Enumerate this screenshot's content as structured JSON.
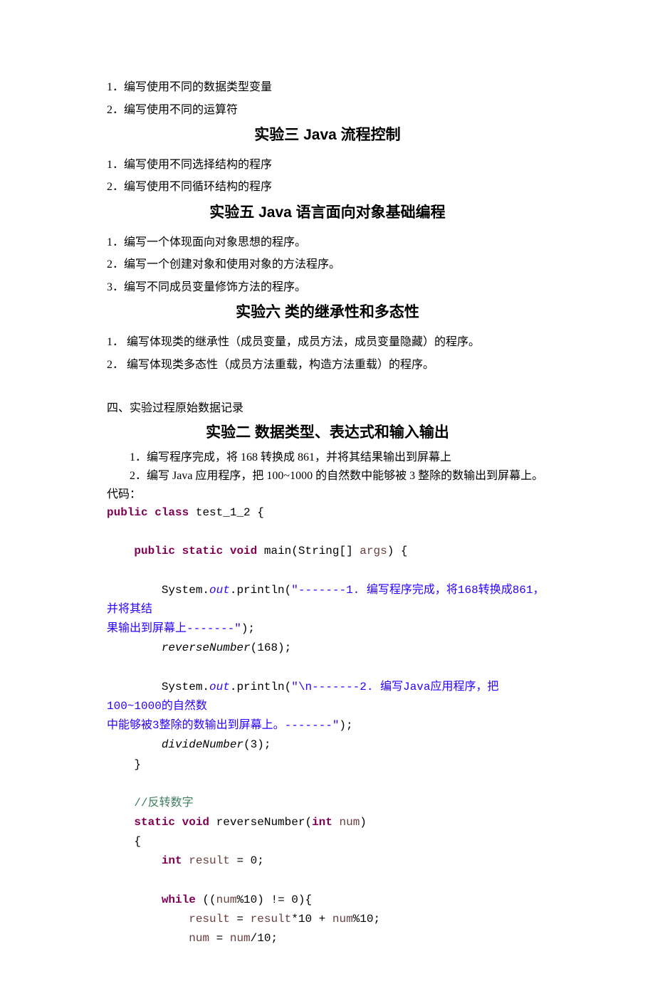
{
  "listTop": [
    "1．编写使用不同的数据类型变量",
    "2．编写使用不同的运算符"
  ],
  "heading3": "实验三  Java 流程控制",
  "list3": [
    "1．编写使用不同选择结构的程序",
    "2．编写使用不同循环结构的程序"
  ],
  "heading5": "实验五  Java 语言面向对象基础编程",
  "list5": [
    "1．编写一个体现面向对象思想的程序。",
    "2．编写一个创建对象和使用对象的方法程序。",
    "3．编写不同成员变量修饰方法的程序。"
  ],
  "heading6": "实验六  类的继承性和多态性",
  "list6": [
    "1． 编写体现类的继承性（成员变量，成员方法，成员变量隐藏）的程序。",
    "2． 编写体现类多态性（成员方法重载，构造方法重载）的程序。"
  ],
  "section4Title": "四、实验过程原始数据记录",
  "heading2b": "实验二  数据类型、表达式和输入输出",
  "sec4List": [
    "1．编写程序完成，将 168 转换成 861，并将其结果输出到屏幕上",
    "2．编写 Java 应用程序，把 100~1000 的自然数中能够被 3 整除的数输出到屏幕上。"
  ],
  "codeLabel": "代码：",
  "code": {
    "public": "public",
    "class": "class",
    "className": "test_1_2",
    "static": "static",
    "void": "void",
    "main": "main",
    "stringArgs": "(String[] ",
    "args": "args",
    "closeParenBrace": ") {",
    "system": "System.",
    "out": "out",
    "println": ".println(",
    "str1a": "\"-------1. 编写程序完成，将168转换成861，并将其结",
    "str1b": "果输出到屏幕上-------\"",
    "semi": ");",
    "reverseNumber": "reverseNumber",
    "rn168": "(168);",
    "str2a": "\"\\n-------2. 编写Java应用程序，把100~1000的自然数",
    "str2b": "中能够被3整除的数输出到屏幕上。-------\"",
    "divideNumber": "divideNumber",
    "dn3": "(3);",
    "rbrace": "}",
    "comment": "//反转数字",
    "rnDecl1": "reverseNumber(",
    "int": "int",
    "num": "num",
    "rnDecl2": ")",
    "lbrace": "{",
    "result": "result",
    "eq0": " = 0;",
    "while": "while",
    "whileCond": " ((",
    "numMod10": "%10)  != 0){",
    "assign1a": " = ",
    "assign1b": "*10 + ",
    "assign1c": "%10;",
    "assign2a": " = ",
    "assign2b": "/10;"
  }
}
